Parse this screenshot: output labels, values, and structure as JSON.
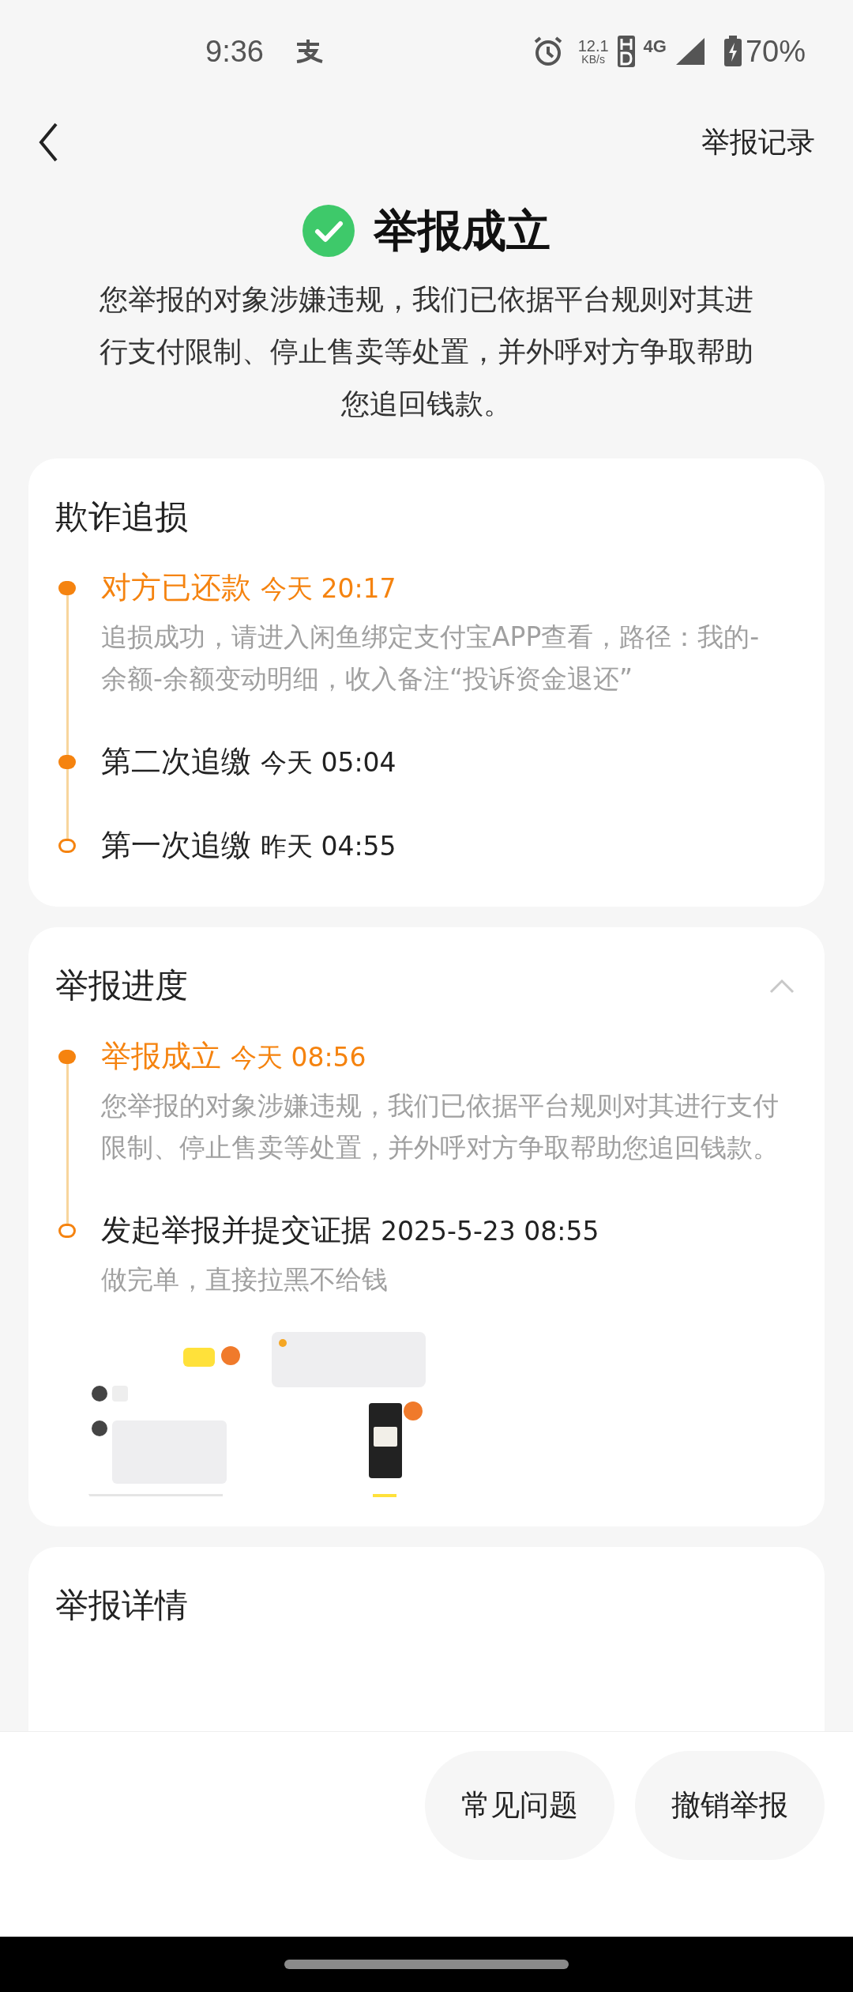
{
  "status_bar": {
    "time": "9:36",
    "net_speed": "12.1",
    "net_unit": "KB/s",
    "network": "4G",
    "battery": "70%"
  },
  "header": {
    "record_link": "举报记录"
  },
  "result": {
    "title": "举报成立",
    "description": "您举报的对象涉嫌违规，我们已依据平台规则对其进行支付限制、停止售卖等处置，并外呼对方争取帮助您追回钱款。"
  },
  "recovery": {
    "title": "欺诈追损",
    "events": [
      {
        "title": "对方已还款",
        "time": "今天 20:17",
        "active": true,
        "filled": true,
        "detail": "追损成功，请进入闲鱼绑定支付宝APP查看，路径：我的-余额-余额变动明细，收入备注“投诉资金退还”"
      },
      {
        "title": "第二次追缴",
        "time": "今天 05:04",
        "active": false,
        "filled": true
      },
      {
        "title": "第一次追缴",
        "time": "昨天 04:55",
        "active": false,
        "filled": false
      }
    ]
  },
  "progress": {
    "title": "举报进度",
    "expanded": true,
    "events": [
      {
        "title": "举报成立",
        "time": "今天 08:56",
        "active": true,
        "filled": true,
        "detail": "您举报的对象涉嫌违规，我们已依据平台规则对其进行支付限制、停止售卖等处置，并外呼对方争取帮助您追回钱款。"
      },
      {
        "title": "发起举报并提交证据",
        "time": "2025-5-23 08:55",
        "active": false,
        "filled": false,
        "detail": "做完单，直接拉黑不给钱"
      }
    ]
  },
  "details": {
    "title": "举报详情"
  },
  "bottom_buttons": [
    "常见问题",
    "撤销举报"
  ]
}
